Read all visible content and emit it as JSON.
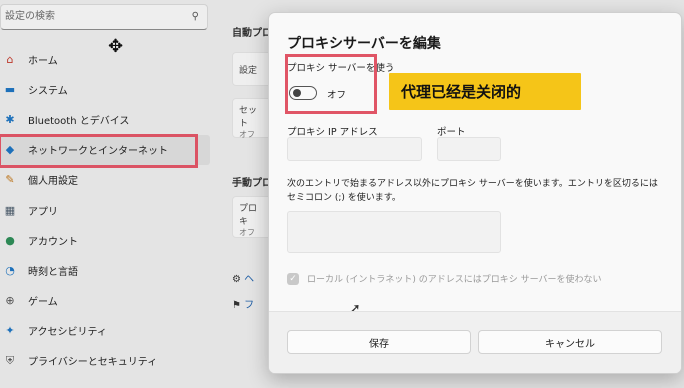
{
  "search": {
    "placeholder": "設定の検索"
  },
  "nav": {
    "items": [
      {
        "label": "ホーム",
        "icon": "home-icon",
        "glyph": "⌂",
        "color": "#c0392b"
      },
      {
        "label": "システム",
        "icon": "monitor-icon",
        "glyph": "▬",
        "color": "#1e73be"
      },
      {
        "label": "Bluetooth とデバイス",
        "icon": "bluetooth-icon",
        "glyph": "✱",
        "color": "#1e73be"
      },
      {
        "label": "ネットワークとインターネット",
        "icon": "wifi-icon",
        "glyph": "◆",
        "color": "#1e73be"
      },
      {
        "label": "個人用設定",
        "icon": "brush-icon",
        "glyph": "✎",
        "color": "#c0761a"
      },
      {
        "label": "アプリ",
        "icon": "apps-icon",
        "glyph": "▦",
        "color": "#4a5a6a"
      },
      {
        "label": "アカウント",
        "icon": "person-icon",
        "glyph": "●",
        "color": "#2e8b57"
      },
      {
        "label": "時刻と言語",
        "icon": "globe-clock-icon",
        "glyph": "◔",
        "color": "#1e73be"
      },
      {
        "label": "ゲーム",
        "icon": "gamepad-icon",
        "glyph": "⊕",
        "color": "#555555"
      },
      {
        "label": "アクセシビリティ",
        "icon": "accessibility-icon",
        "glyph": "✦",
        "color": "#1e73be"
      },
      {
        "label": "プライバシーとセキュリティ",
        "icon": "shield-icon",
        "glyph": "⛨",
        "color": "#555555"
      }
    ]
  },
  "background": {
    "auto_section": "自動プロ",
    "auto_card_label": "設定",
    "setup_card_label": "セット",
    "setup_card_sub": "オフ",
    "manual_section": "手動プロ",
    "proxy_card_label": "プロキ",
    "proxy_card_sub": "オフ",
    "help_link": "ヘ",
    "feedback_link": "フ"
  },
  "modal": {
    "title": "プロキシサーバーを編集",
    "use_proxy_label": "プロキシ サーバーを使う",
    "toggle_state": "オフ",
    "annotation": "代理已经是关闭的",
    "ip_label": "プロキシ IP アドレス",
    "port_label": "ポート",
    "ip_value": "",
    "port_value": "",
    "exceptions_text": "次のエントリで始まるアドレス以外にプロキシ サーバーを使います。エントリを区切るにはセミコロン (;) を使います。",
    "exceptions_value": "",
    "local_checkbox_label": "ローカル (イントラネット) のアドレスにはプロキシ サーバーを使わない",
    "save_label": "保存",
    "cancel_label": "キャンセル"
  },
  "colors": {
    "annotation_bg": "#f5c518",
    "highlight_border": "#e05566"
  }
}
